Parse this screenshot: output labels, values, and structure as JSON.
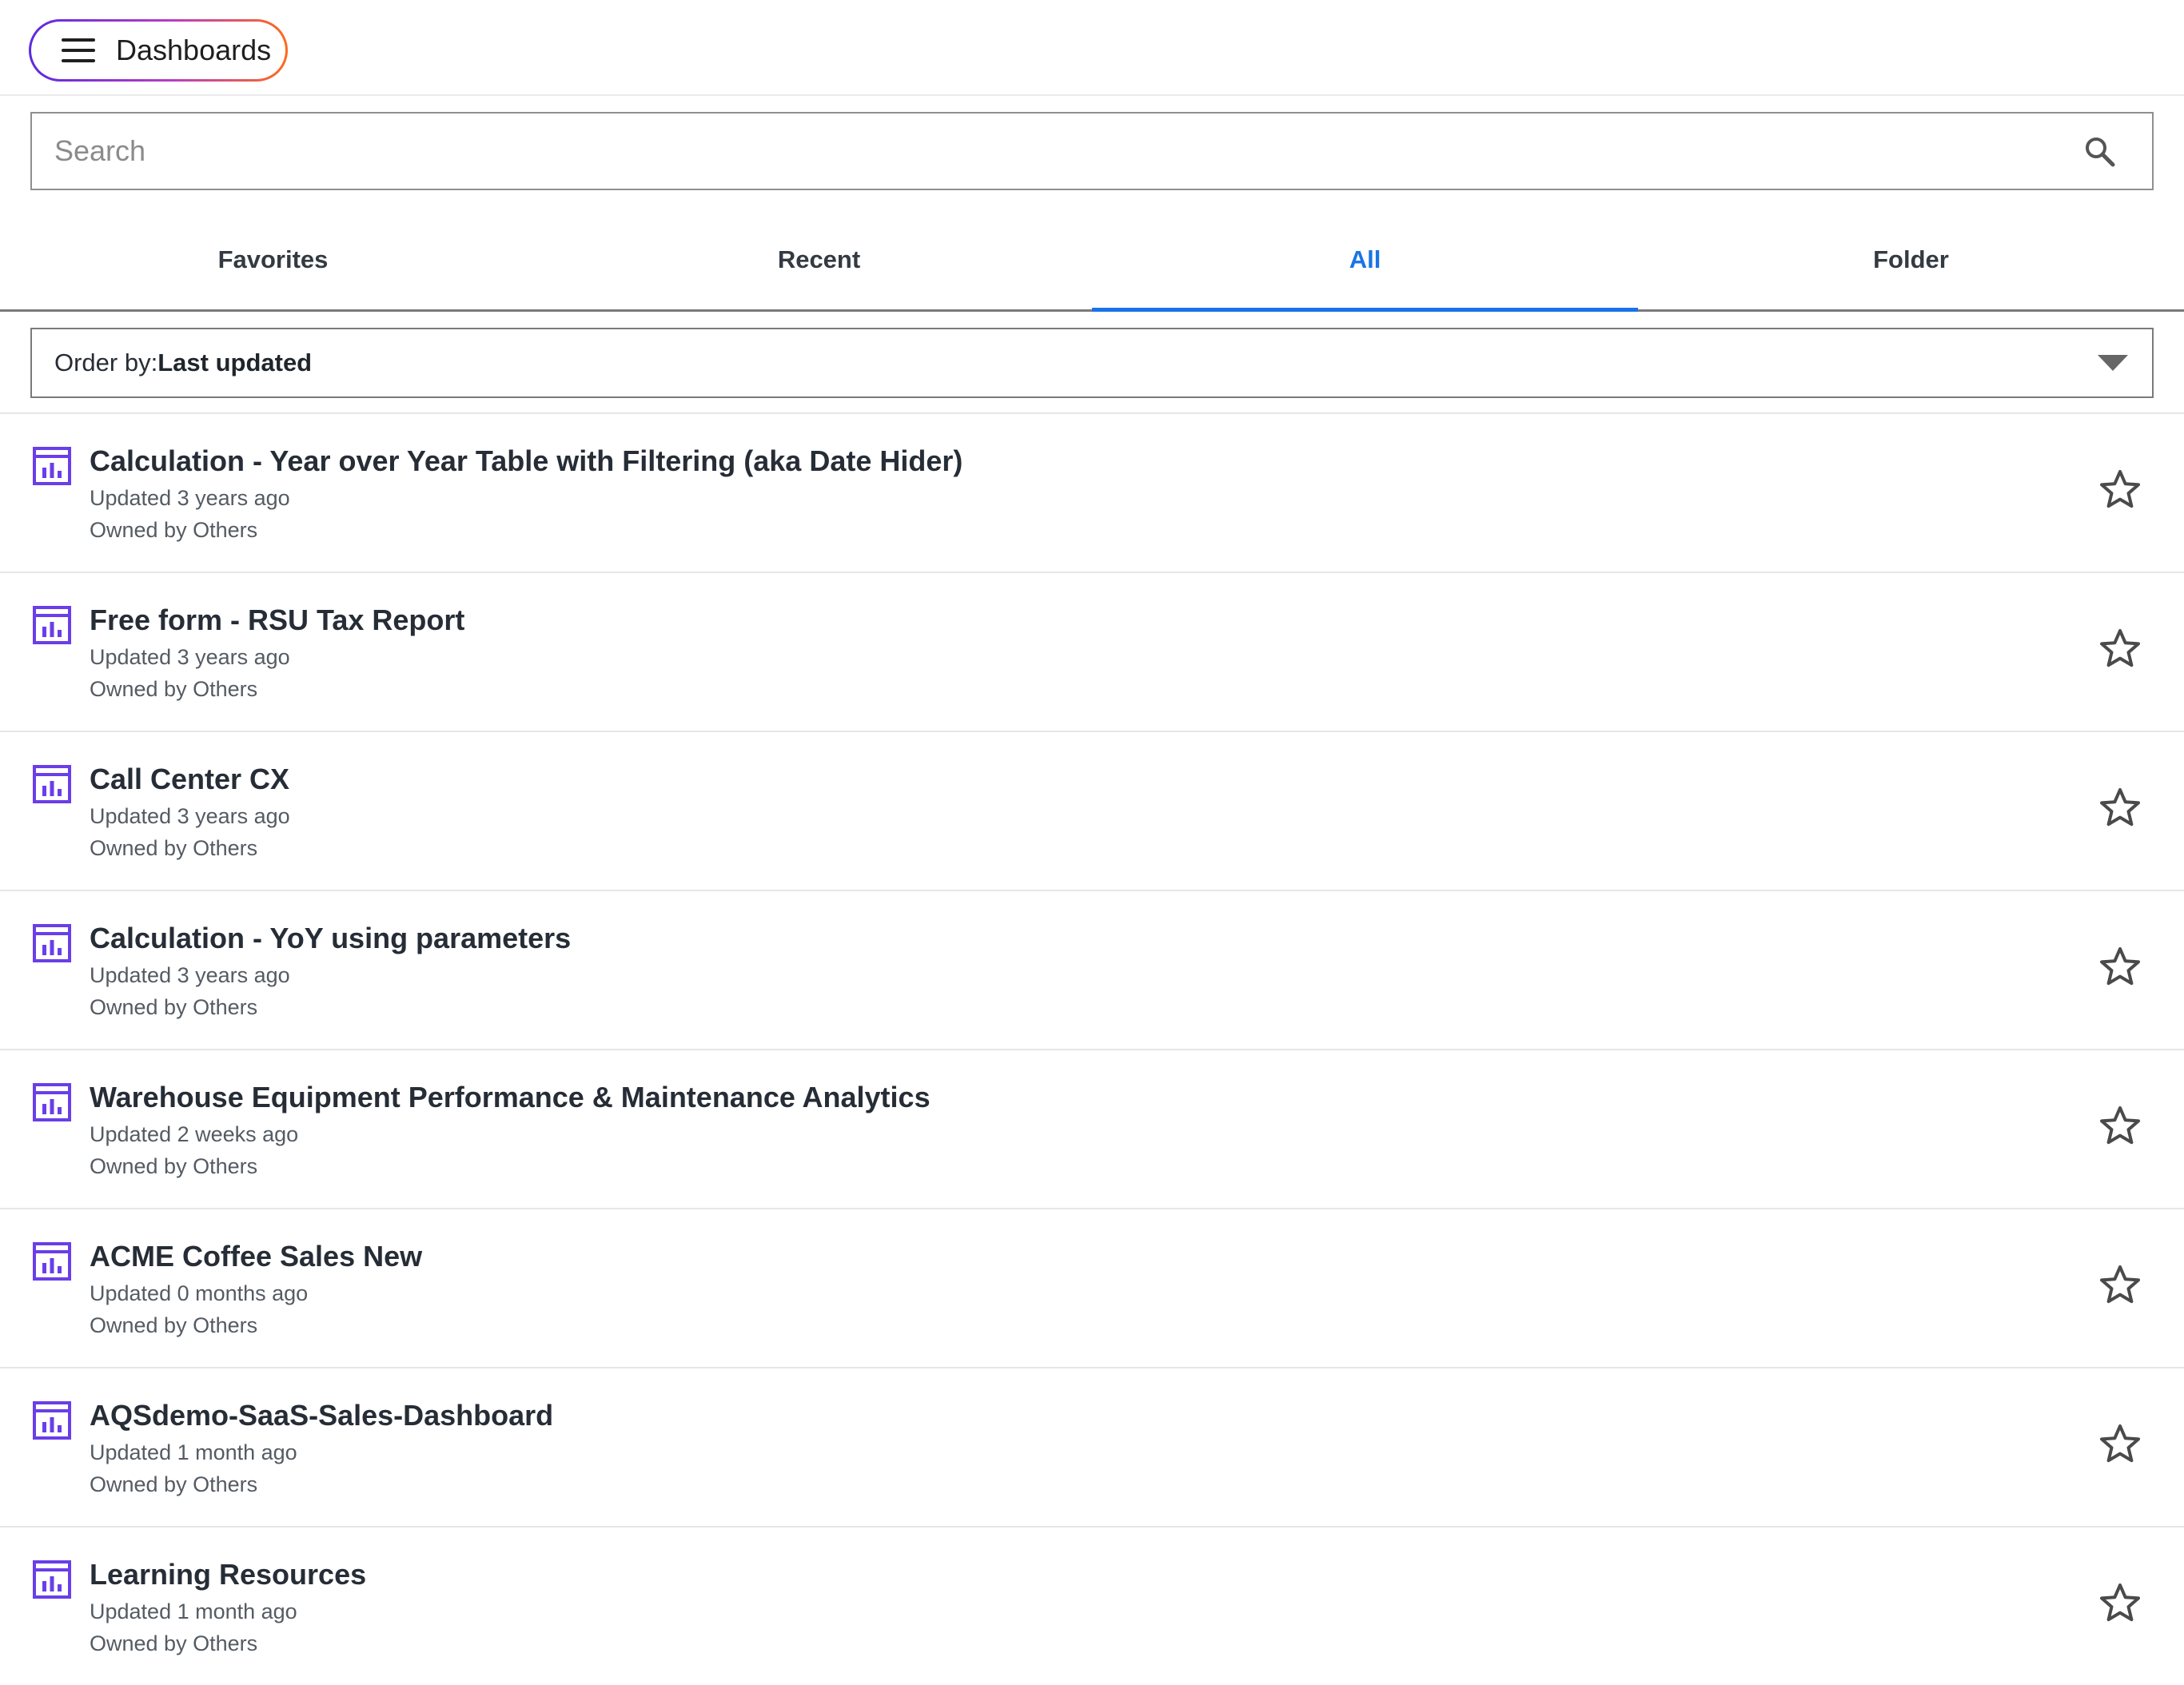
{
  "header": {
    "menu_title": "Dashboards"
  },
  "search": {
    "placeholder": "Search",
    "value": ""
  },
  "tabs": [
    {
      "label": "Favorites",
      "active": false
    },
    {
      "label": "Recent",
      "active": false
    },
    {
      "label": "All",
      "active": true
    },
    {
      "label": "Folder",
      "active": false
    }
  ],
  "order": {
    "label": "Order by:",
    "value": "Last updated"
  },
  "colors": {
    "accent": "#1a73e8",
    "dashboard_icon": "#6a3ee8",
    "pill_gradient": [
      "#5b2be0",
      "#b83cc4",
      "#ff6a1a"
    ]
  },
  "icons": {
    "menu": "hamburger-icon",
    "search": "search-icon",
    "dropdown": "chevron-down-icon",
    "item": "dashboard-chart-icon",
    "favorite": "star-icon"
  },
  "dashboards": [
    {
      "title": "Calculation - Year over Year Table with Filtering (aka Date Hider)",
      "updated": "Updated 3 years ago",
      "owner": "Owned by Others"
    },
    {
      "title": "Free form - RSU Tax Report",
      "updated": "Updated 3 years ago",
      "owner": "Owned by Others"
    },
    {
      "title": "Call Center CX",
      "updated": "Updated 3 years ago",
      "owner": "Owned by Others"
    },
    {
      "title": "Calculation - YoY using parameters",
      "updated": "Updated 3 years ago",
      "owner": "Owned by Others"
    },
    {
      "title": "Warehouse Equipment Performance & Maintenance Analytics",
      "updated": "Updated 2 weeks ago",
      "owner": "Owned by Others"
    },
    {
      "title": "ACME Coffee Sales New",
      "updated": "Updated 0 months ago",
      "owner": "Owned by Others"
    },
    {
      "title": "AQSdemo-SaaS-Sales-Dashboard",
      "updated": "Updated 1 month ago",
      "owner": "Owned by Others"
    },
    {
      "title": "Learning Resources",
      "updated": "Updated 1 month ago",
      "owner": "Owned by Others"
    }
  ]
}
